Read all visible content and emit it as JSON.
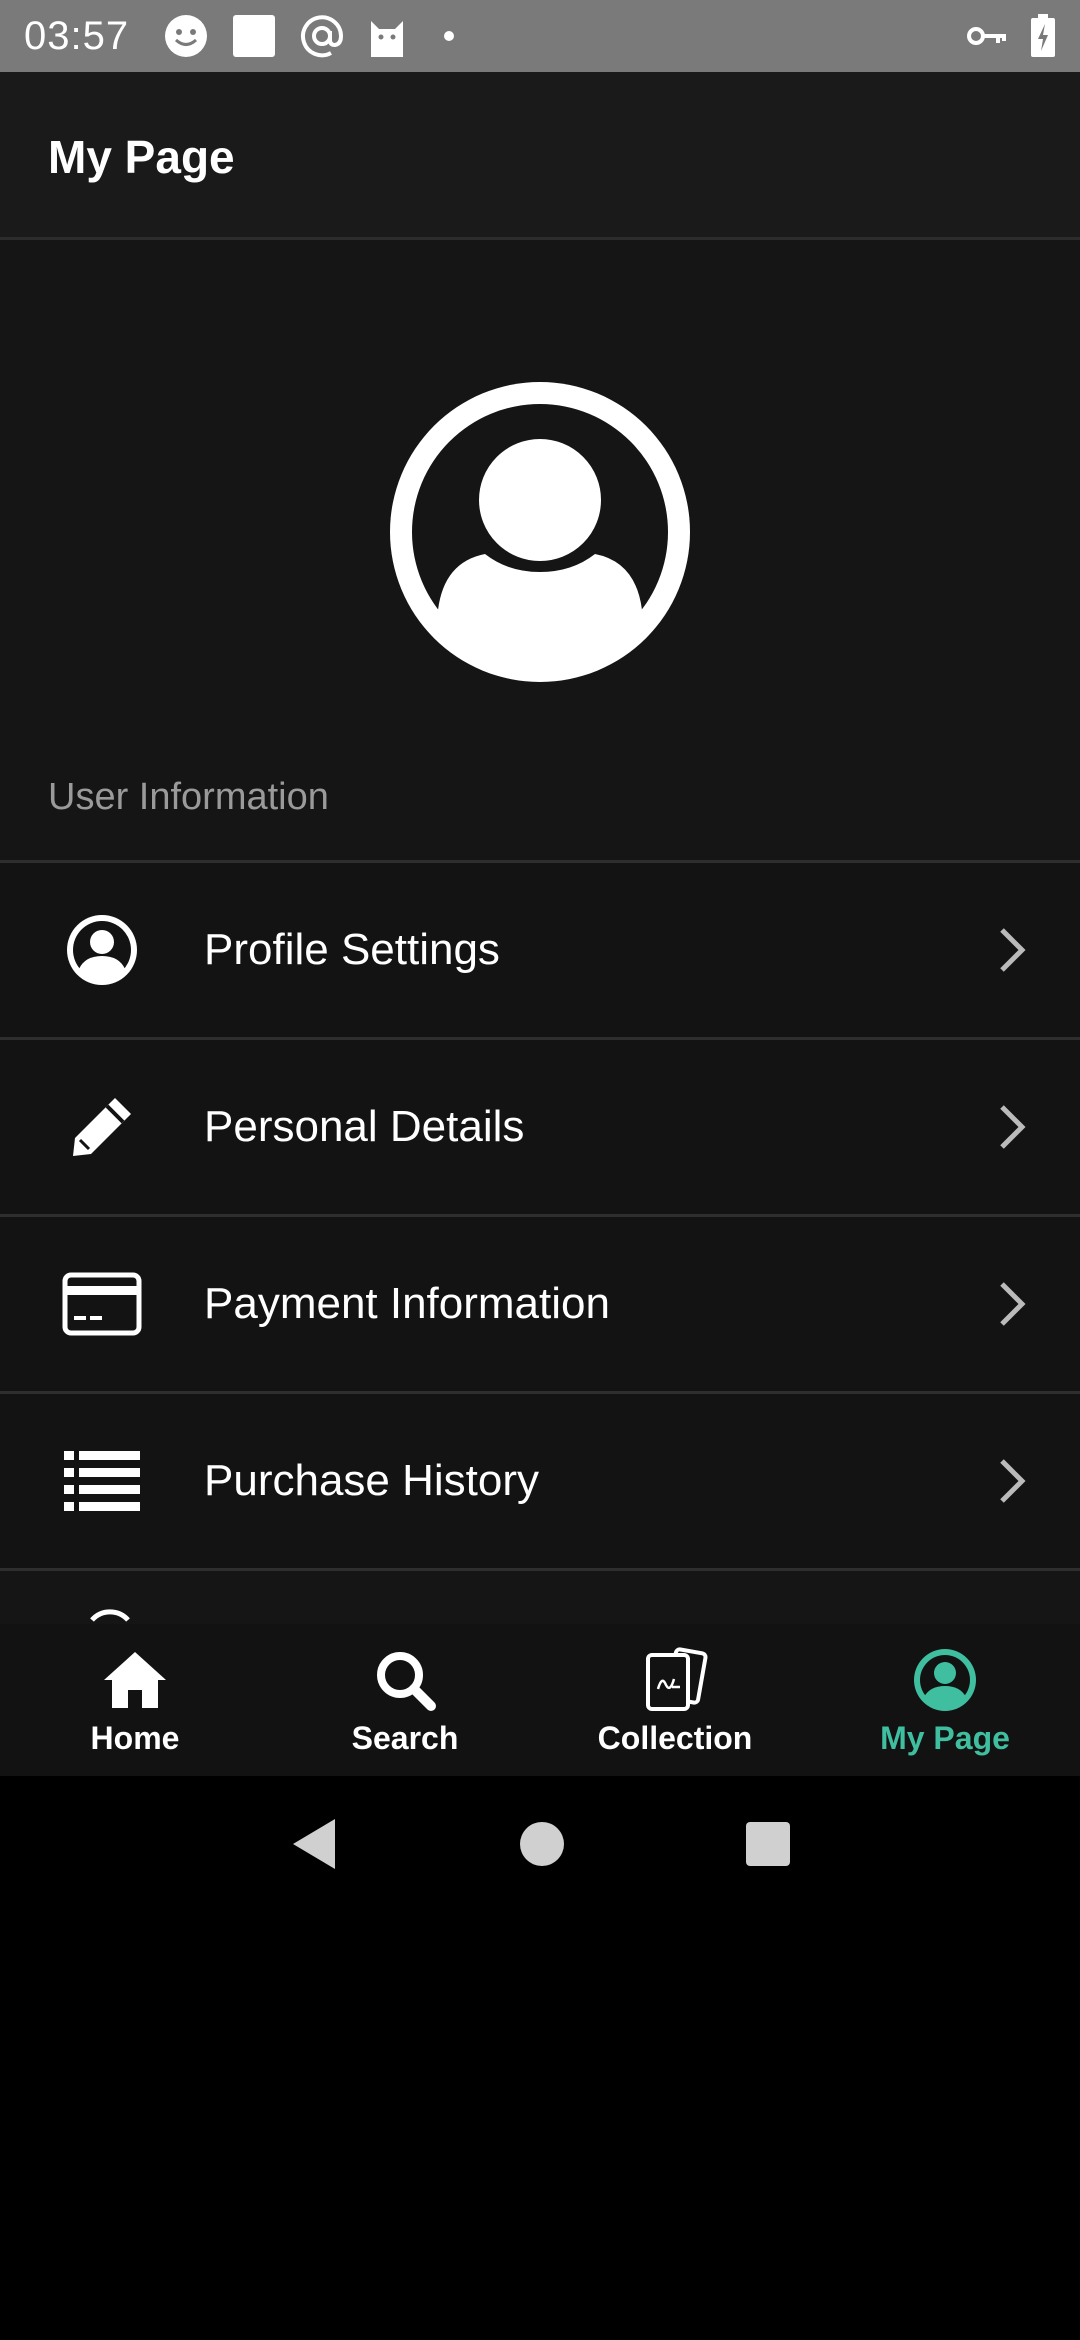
{
  "status_bar": {
    "time": "03:57",
    "left_icons": [
      "smiley-icon",
      "square-icon",
      "at-sign-icon",
      "cat-icon",
      "dot-icon"
    ],
    "right_icons": [
      "key-icon",
      "battery-charging-icon"
    ]
  },
  "header": {
    "title": "My Page"
  },
  "profile": {
    "avatar": "account-circle-icon"
  },
  "section": {
    "label": "User Information"
  },
  "menu": {
    "items": [
      {
        "label": "Profile Settings",
        "icon": "account-circle-icon"
      },
      {
        "label": "Personal Details",
        "icon": "pencil-icon"
      },
      {
        "label": "Payment Information",
        "icon": "credit-card-icon"
      },
      {
        "label": "Purchase History",
        "icon": "list-icon"
      }
    ]
  },
  "bottom_nav": {
    "items": [
      {
        "label": "Home",
        "icon": "home-icon",
        "active": false
      },
      {
        "label": "Search",
        "icon": "search-icon",
        "active": false
      },
      {
        "label": "Collection",
        "icon": "cards-icon",
        "active": false
      },
      {
        "label": "My Page",
        "icon": "account-circle-icon",
        "active": true
      }
    ]
  },
  "colors": {
    "accent": "#3fbfa0",
    "background": "#151515",
    "status_bar": "#7a7a7a",
    "section_label": "#9a9a9a"
  },
  "system_nav": [
    "back-icon",
    "home-circle-icon",
    "recents-icon"
  ]
}
